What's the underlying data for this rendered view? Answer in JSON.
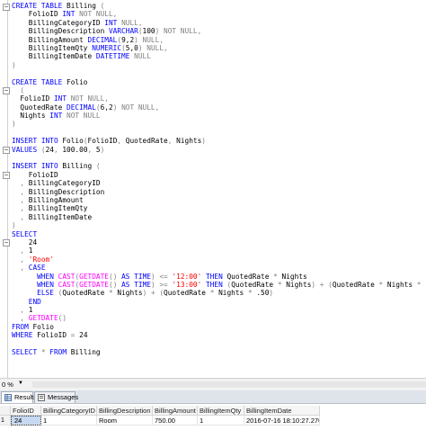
{
  "editor": {
    "lines": [
      [
        [
          "kw",
          "CREATE TABLE "
        ],
        [
          "tx",
          "Billing "
        ],
        [
          "gr",
          "("
        ]
      ],
      [
        [
          "tx",
          "    FolioID "
        ],
        [
          "ty",
          "INT "
        ],
        [
          "gr",
          "NOT NULL,"
        ]
      ],
      [
        [
          "tx",
          "    BillingCategoryID "
        ],
        [
          "ty",
          "INT "
        ],
        [
          "gr",
          "NULL,"
        ]
      ],
      [
        [
          "tx",
          "    BillingDescription "
        ],
        [
          "ty",
          "VARCHAR"
        ],
        [
          "gr",
          "("
        ],
        [
          "tx",
          "100"
        ],
        [
          "gr",
          ") NOT NULL,"
        ]
      ],
      [
        [
          "tx",
          "    BillingAmount "
        ],
        [
          "ty",
          "DECIMAL"
        ],
        [
          "gr",
          "("
        ],
        [
          "tx",
          "9,2"
        ],
        [
          "gr",
          ") NULL,"
        ]
      ],
      [
        [
          "tx",
          "    BillingItemQty "
        ],
        [
          "ty",
          "NUMERIC"
        ],
        [
          "gr",
          "("
        ],
        [
          "tx",
          "5,0"
        ],
        [
          "gr",
          ") NULL,"
        ]
      ],
      [
        [
          "tx",
          "    BillingItemDate "
        ],
        [
          "ty",
          "DATETIME "
        ],
        [
          "gr",
          "NULL"
        ]
      ],
      [
        [
          "gr",
          ")"
        ]
      ],
      [
        [
          "tx",
          ""
        ]
      ],
      [
        [
          "kw",
          "CREATE TABLE "
        ],
        [
          "tx",
          "Folio"
        ]
      ],
      [
        [
          "gr",
          "  ("
        ]
      ],
      [
        [
          "tx",
          "  FolioID "
        ],
        [
          "ty",
          "INT "
        ],
        [
          "gr",
          "NOT NULL,"
        ]
      ],
      [
        [
          "tx",
          "  QuotedRate "
        ],
        [
          "ty",
          "DECIMAL"
        ],
        [
          "gr",
          "("
        ],
        [
          "tx",
          "6,2"
        ],
        [
          "gr",
          ") NOT NULL,"
        ]
      ],
      [
        [
          "tx",
          "  Nights "
        ],
        [
          "ty",
          "INT "
        ],
        [
          "gr",
          "NOT NULL"
        ]
      ],
      [
        [
          "gr",
          ")"
        ]
      ],
      [
        [
          "tx",
          ""
        ]
      ],
      [
        [
          "kw",
          "INSERT INTO "
        ],
        [
          "tx",
          "Folio"
        ],
        [
          "gr",
          "("
        ],
        [
          "tx",
          "FolioID"
        ],
        [
          "gr",
          ", "
        ],
        [
          "tx",
          "QuotedRate"
        ],
        [
          "gr",
          ", "
        ],
        [
          "tx",
          "Nights"
        ],
        [
          "gr",
          ")"
        ]
      ],
      [
        [
          "kw",
          "VALUES "
        ],
        [
          "gr",
          "("
        ],
        [
          "tx",
          "24"
        ],
        [
          "gr",
          ", "
        ],
        [
          "tx",
          "100.00"
        ],
        [
          "gr",
          ", "
        ],
        [
          "tx",
          "5"
        ],
        [
          "gr",
          ")"
        ]
      ],
      [
        [
          "tx",
          ""
        ]
      ],
      [
        [
          "kw",
          "INSERT INTO "
        ],
        [
          "tx",
          "Billing "
        ],
        [
          "gr",
          "("
        ]
      ],
      [
        [
          "tx",
          "    FolioID"
        ]
      ],
      [
        [
          "gr",
          "  , "
        ],
        [
          "tx",
          "BillingCategoryID"
        ]
      ],
      [
        [
          "gr",
          "  , "
        ],
        [
          "tx",
          "BillingDescription"
        ]
      ],
      [
        [
          "gr",
          "  , "
        ],
        [
          "tx",
          "BillingAmount"
        ]
      ],
      [
        [
          "gr",
          "  , "
        ],
        [
          "tx",
          "BillingItemQty"
        ]
      ],
      [
        [
          "gr",
          "  , "
        ],
        [
          "tx",
          "BillingItemDate"
        ]
      ],
      [
        [
          "gr",
          ")"
        ]
      ],
      [
        [
          "kw",
          "SELECT"
        ]
      ],
      [
        [
          "tx",
          "    24"
        ]
      ],
      [
        [
          "gr",
          "  , "
        ],
        [
          "tx",
          "1"
        ]
      ],
      [
        [
          "gr",
          "  , "
        ],
        [
          "st",
          "'Room'"
        ]
      ],
      [
        [
          "gr",
          "  , "
        ],
        [
          "kw",
          "CASE"
        ]
      ],
      [
        [
          "tx",
          "      "
        ],
        [
          "kw",
          "WHEN "
        ],
        [
          "fn",
          "CAST"
        ],
        [
          "gr",
          "("
        ],
        [
          "fn",
          "GETDATE"
        ],
        [
          "gr",
          "() "
        ],
        [
          "kw",
          "AS TIME"
        ],
        [
          "gr",
          ") <= "
        ],
        [
          "st",
          "'12:00' "
        ],
        [
          "kw",
          "THEN "
        ],
        [
          "tx",
          "QuotedRate "
        ],
        [
          "gr",
          "* "
        ],
        [
          "tx",
          "Nights"
        ]
      ],
      [
        [
          "tx",
          "      "
        ],
        [
          "kw",
          "WHEN "
        ],
        [
          "fn",
          "CAST"
        ],
        [
          "gr",
          "("
        ],
        [
          "fn",
          "GETDATE"
        ],
        [
          "gr",
          "() "
        ],
        [
          "kw",
          "AS TIME"
        ],
        [
          "gr",
          ") >= "
        ],
        [
          "st",
          "'13:00' "
        ],
        [
          "kw",
          "THEN "
        ],
        [
          "gr",
          "("
        ],
        [
          "tx",
          "QuotedRate "
        ],
        [
          "gr",
          "* "
        ],
        [
          "tx",
          "Nights"
        ],
        [
          "gr",
          ") + ("
        ],
        [
          "tx",
          "QuotedRate "
        ],
        [
          "gr",
          "* "
        ],
        [
          "tx",
          "Nights "
        ],
        [
          "gr",
          "* "
        ],
        [
          "tx",
          ".50"
        ],
        [
          "gr",
          ")"
        ]
      ],
      [
        [
          "tx",
          "      "
        ],
        [
          "kw",
          "ELSE "
        ],
        [
          "gr",
          "("
        ],
        [
          "tx",
          "QuotedRate "
        ],
        [
          "gr",
          "* "
        ],
        [
          "tx",
          "Nights"
        ],
        [
          "gr",
          ") + ("
        ],
        [
          "tx",
          "QuotedRate "
        ],
        [
          "gr",
          "* "
        ],
        [
          "tx",
          "Nights "
        ],
        [
          "gr",
          "* "
        ],
        [
          "tx",
          ".50"
        ],
        [
          "gr",
          ")"
        ]
      ],
      [
        [
          "tx",
          "    "
        ],
        [
          "kw",
          "END"
        ]
      ],
      [
        [
          "gr",
          "  , "
        ],
        [
          "tx",
          "1"
        ]
      ],
      [
        [
          "gr",
          "  , "
        ],
        [
          "fn",
          "GETDATE"
        ],
        [
          "gr",
          "()"
        ]
      ],
      [
        [
          "kw",
          "FROM "
        ],
        [
          "tx",
          "Folio"
        ]
      ],
      [
        [
          "kw",
          "WHERE "
        ],
        [
          "tx",
          "FolioID "
        ],
        [
          "gr",
          "= "
        ],
        [
          "tx",
          "24"
        ]
      ],
      [
        [
          "tx",
          ""
        ]
      ],
      [
        [
          "kw",
          "SELECT "
        ],
        [
          "gr",
          "* "
        ],
        [
          "kw",
          "FROM "
        ],
        [
          "tx",
          "Billing"
        ]
      ]
    ],
    "folds": [
      "−",
      "−",
      "−",
      "−",
      "−"
    ]
  },
  "zoombar": {
    "zoom": "0 %",
    "arrow": "▼"
  },
  "tabs": [
    {
      "label": "Results",
      "active": true,
      "icon": "grid-icon"
    },
    {
      "label": "Messages",
      "active": false,
      "icon": "messages-icon"
    }
  ],
  "results": {
    "columns": [
      "FolioID",
      "BillingCategoryID",
      "BillingDescription",
      "BillingAmount",
      "BillingItemQty",
      "BillingItemDate"
    ],
    "rows": [
      {
        "num": "1",
        "cells": [
          "24",
          "1",
          "Room",
          "750.00",
          "1",
          "2016-07-16 18:10:27.270"
        ]
      }
    ]
  },
  "colors": {
    "keyword": "#0000ff",
    "operator": "#808080",
    "function": "#ff00ff",
    "string": "#ff0000",
    "selected_cell": "#c7d9f0"
  }
}
